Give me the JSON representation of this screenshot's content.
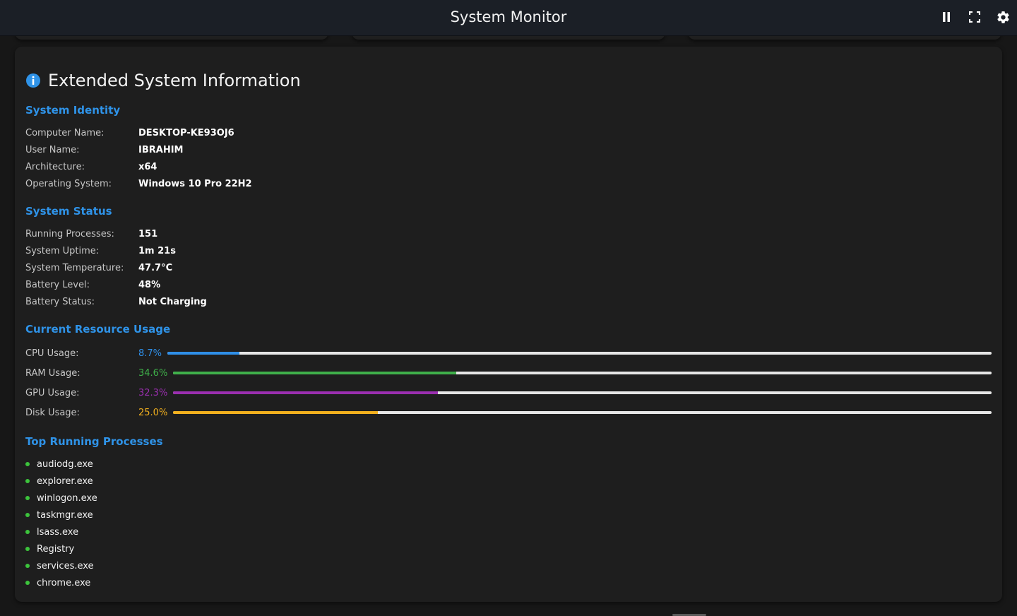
{
  "app": {
    "title": "System Monitor"
  },
  "toolbar": {
    "icons": [
      "pause-icon",
      "fullscreen-icon",
      "gear-icon"
    ]
  },
  "panel": {
    "title": "Extended System Information",
    "icon": "info-icon"
  },
  "identity": {
    "title": "System Identity",
    "rows": [
      {
        "label": "Computer Name:",
        "value": "DESKTOP-KE93OJ6"
      },
      {
        "label": "User Name:",
        "value": "IBRAHIM"
      },
      {
        "label": "Architecture:",
        "value": "x64"
      },
      {
        "label": "Operating System:",
        "value": "Windows 10 Pro 22H2"
      }
    ]
  },
  "status": {
    "title": "System Status",
    "rows": [
      {
        "label": "Running Processes:",
        "value": "151"
      },
      {
        "label": "System Uptime:",
        "value": "1m 21s"
      },
      {
        "label": "System Temperature:",
        "value": "47.7°C"
      },
      {
        "label": "Battery Level:",
        "value": "48%"
      },
      {
        "label": "Battery Status:",
        "value": "Not Charging"
      }
    ]
  },
  "usage": {
    "title": "Current Resource Usage",
    "rows": [
      {
        "label": "CPU Usage:",
        "value": "8.7%",
        "percent": 8.7,
        "color": "#2f8fe8"
      },
      {
        "label": "RAM Usage:",
        "value": "34.6%",
        "percent": 34.6,
        "color": "#3fb04a"
      },
      {
        "label": "GPU Usage:",
        "value": "32.3%",
        "percent": 32.3,
        "color": "#9b2fb0"
      },
      {
        "label": "Disk Usage:",
        "value": "25.0%",
        "percent": 25.0,
        "color": "#f2b01e"
      }
    ]
  },
  "processes": {
    "title": "Top Running Processes",
    "items": [
      "audiodg.exe",
      "explorer.exe",
      "winlogon.exe",
      "taskmgr.exe",
      "lsass.exe",
      "Registry",
      "services.exe",
      "chrome.exe"
    ]
  },
  "colors": {
    "accent": "#2f93e8",
    "process_dot": "#3cc43c",
    "background": "#171717",
    "panel": "#1e1e1e"
  }
}
